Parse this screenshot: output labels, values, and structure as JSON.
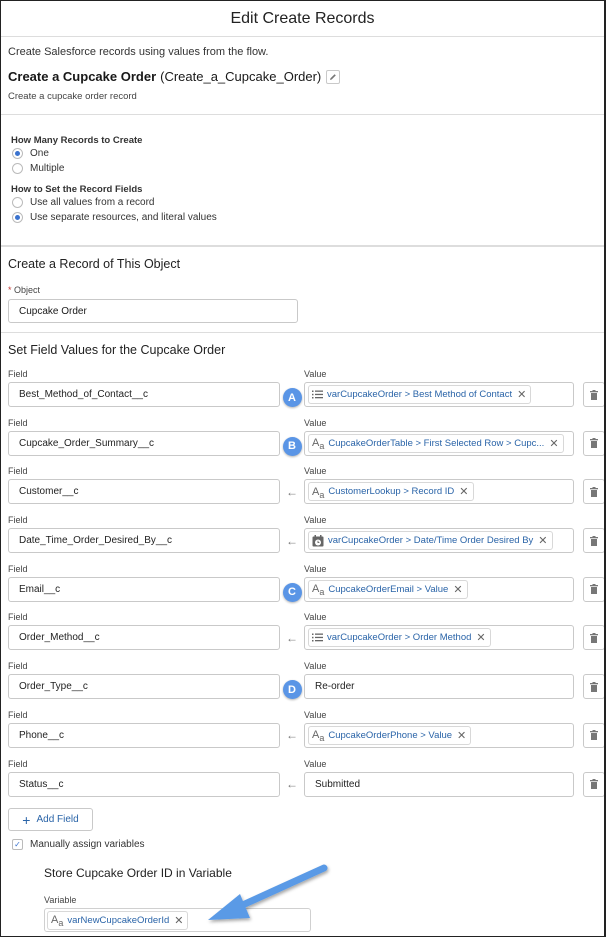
{
  "modal": {
    "title": "Edit Create Records"
  },
  "element": {
    "description": "Create Salesforce records using values from the flow.",
    "label": "Create a Cupcake Order",
    "api_name": "(Create_a_Cupcake_Order)",
    "subtitle": "Create a cupcake order record",
    "edit_icon": "pencil-icon"
  },
  "how_many": {
    "label": "How Many Records to Create",
    "options": [
      {
        "label": "One",
        "selected": true
      },
      {
        "label": "Multiple",
        "selected": false
      }
    ]
  },
  "how_set": {
    "label": "How to Set the Record Fields",
    "options": [
      {
        "label": "Use all values from a record",
        "selected": false
      },
      {
        "label": "Use separate resources, and literal values",
        "selected": true
      }
    ]
  },
  "object_section": {
    "heading": "Create a Record of This Object",
    "required_marker": "*",
    "object_label": "Object",
    "object_value": "Cupcake Order"
  },
  "field_values": {
    "heading": "Set Field Values for the Cupcake Order",
    "field_label": "Field",
    "value_label": "Value",
    "connector_icon": "arrow-left-icon",
    "delete_icon": "trash-icon",
    "rows": [
      {
        "field": "Best_Method_of_Contact__c",
        "badge": "A",
        "value_type": "picklist",
        "value": "varCupcakeOrder > Best Method of Contact",
        "is_resource": true
      },
      {
        "field": "Cupcake_Order_Summary__c",
        "badge": "B",
        "value_type": "text",
        "value": "CupcakeOrderTable > First Selected Row > Cupc...",
        "is_resource": true
      },
      {
        "field": "Customer__c",
        "badge": "",
        "value_type": "text",
        "value": "CustomerLookup > Record ID",
        "is_resource": true
      },
      {
        "field": "Date_Time_Order_Desired_By__c",
        "badge": "",
        "value_type": "datetime",
        "value": "varCupcakeOrder > Date/Time Order Desired By",
        "is_resource": true
      },
      {
        "field": "Email__c",
        "badge": "C",
        "value_type": "text",
        "value": "CupcakeOrderEmail > Value",
        "is_resource": true
      },
      {
        "field": "Order_Method__c",
        "badge": "",
        "value_type": "picklist",
        "value": "varCupcakeOrder > Order Method",
        "is_resource": true
      },
      {
        "field": "Order_Type__c",
        "badge": "D",
        "value_type": "literal",
        "value": "Re-order",
        "is_resource": false
      },
      {
        "field": "Phone__c",
        "badge": "",
        "value_type": "text",
        "value": "CupcakeOrderPhone > Value",
        "is_resource": true
      },
      {
        "field": "Status__c",
        "badge": "",
        "value_type": "literal",
        "value": "Submitted",
        "is_resource": false
      }
    ],
    "add_field_label": "Add Field"
  },
  "manual_assign": {
    "label": "Manually assign variables",
    "checked": true
  },
  "store": {
    "heading": "Store Cupcake Order ID in Variable",
    "variable_label": "Variable",
    "variable_value": "varNewCupcakeOrderId"
  },
  "annotation": {
    "arrow_color": "#5a9ae6",
    "badge_color": "#5a95e6"
  }
}
